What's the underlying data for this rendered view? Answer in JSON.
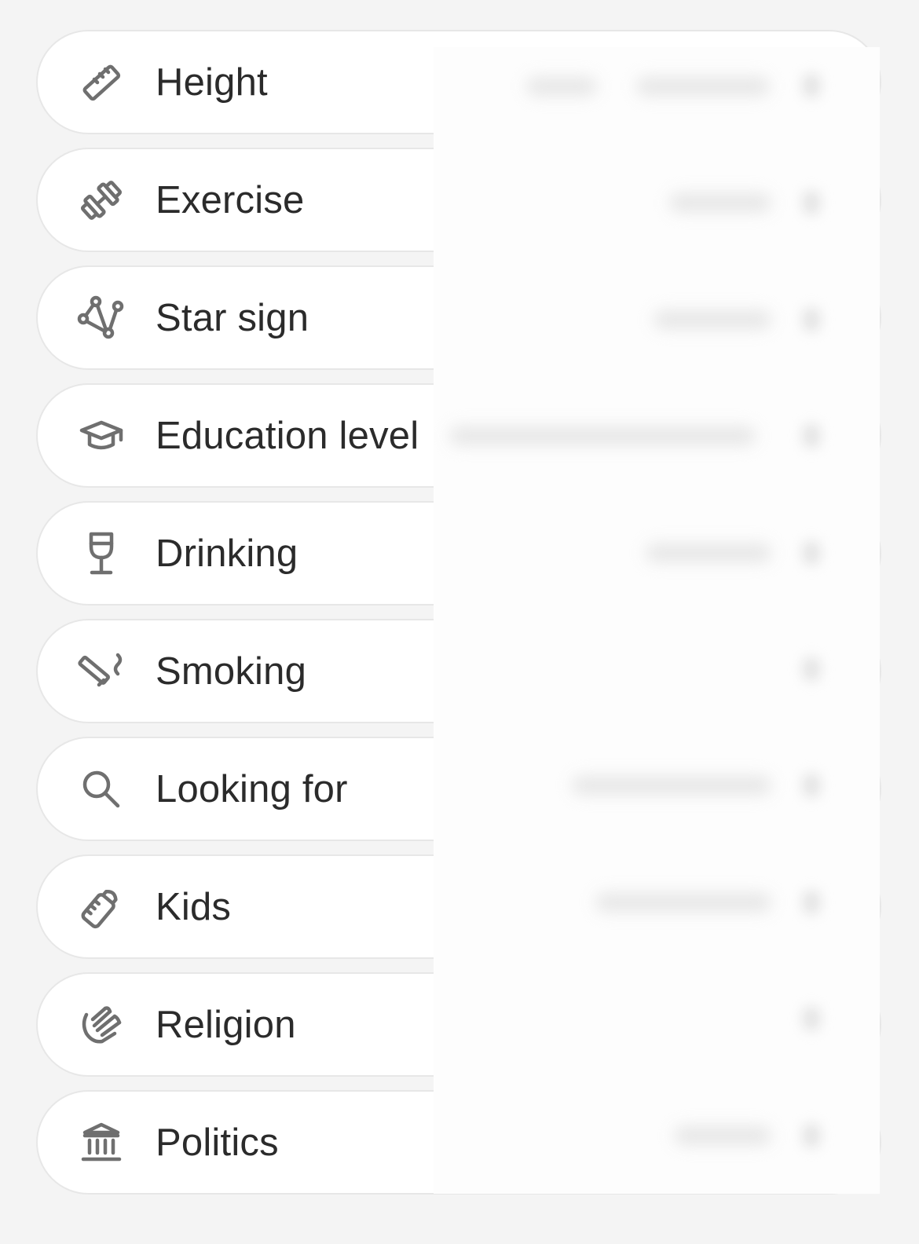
{
  "rows": [
    {
      "label": "Height",
      "icon": "ruler-icon"
    },
    {
      "label": "Exercise",
      "icon": "dumbbell-icon"
    },
    {
      "label": "Star sign",
      "icon": "constellation-icon"
    },
    {
      "label": "Education level",
      "icon": "graduation-cap-icon"
    },
    {
      "label": "Drinking",
      "icon": "wine-glass-icon"
    },
    {
      "label": "Smoking",
      "icon": "cigarette-icon"
    },
    {
      "label": "Looking for",
      "icon": "magnifier-icon"
    },
    {
      "label": "Kids",
      "icon": "baby-bottle-icon"
    },
    {
      "label": "Religion",
      "icon": "praying-hands-icon"
    },
    {
      "label": "Politics",
      "icon": "institution-icon"
    }
  ],
  "colors": {
    "background": "#f4f4f4",
    "row_background": "#ffffff",
    "row_border": "#e7e7e7",
    "label": "#2b2b2b",
    "icon": "#6f6f6f"
  }
}
